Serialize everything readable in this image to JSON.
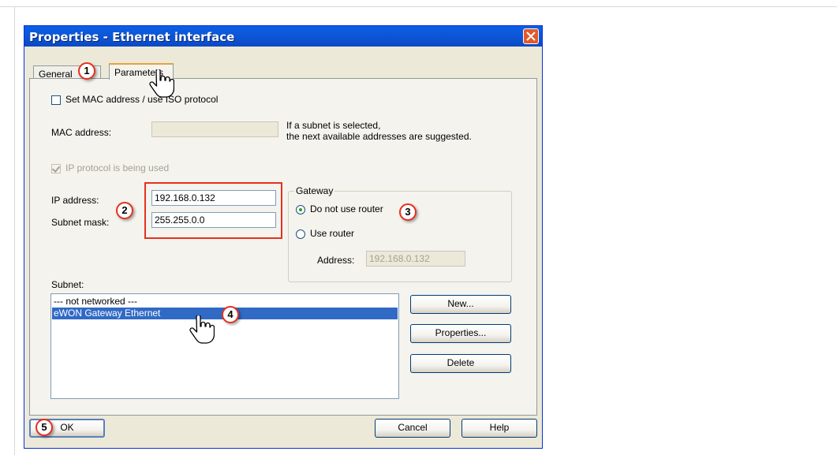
{
  "dialog": {
    "title": "Properties - Ethernet interface",
    "tabs": [
      {
        "label": "General",
        "active": false
      },
      {
        "label": "Parameters",
        "active": true
      }
    ]
  },
  "parameters": {
    "set_mac_label": "Set MAC address / use ISO protocol",
    "set_mac_checked": false,
    "mac_address_label": "MAC address:",
    "mac_address_value": "",
    "mac_hint_line1": "If a subnet is selected,",
    "mac_hint_line2": "the next available addresses are suggested.",
    "ip_protocol_label": "IP protocol is being used",
    "ip_protocol_checked": true,
    "ip_address_label": "IP address:",
    "ip_address_value": "192.168.0.132",
    "subnet_mask_label": "Subnet mask:",
    "subnet_mask_value": "255.255.0.0"
  },
  "gateway": {
    "title": "Gateway",
    "option_no_router": "Do not use router",
    "option_use_router": "Use router",
    "selected": "Do not use router",
    "address_label": "Address:",
    "address_value": "192.168.0.132"
  },
  "subnet": {
    "label": "Subnet:",
    "items": [
      "--- not networked ---",
      "eWON Gateway Ethernet"
    ],
    "selected_index": 1,
    "buttons": {
      "new": "New...",
      "properties": "Properties...",
      "delete": "Delete"
    }
  },
  "footer": {
    "ok": "OK",
    "cancel": "Cancel",
    "help": "Help"
  },
  "callouts": [
    "1",
    "2",
    "3",
    "4",
    "5"
  ],
  "colors": {
    "callout_ring": "#e53120",
    "title_bar": "#0a5fe7",
    "selection": "#316ac5",
    "dialog_face": "#ece9d8"
  }
}
